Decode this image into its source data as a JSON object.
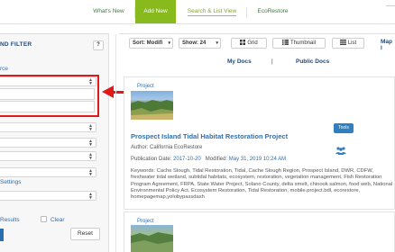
{
  "nav": {
    "tabs": [
      {
        "label": "What's New"
      },
      {
        "label": "Add New"
      },
      {
        "label": "Search & List View"
      },
      {
        "label": "EcoRestore"
      }
    ]
  },
  "filter": {
    "title": "ND FILTER",
    "help_label": "?",
    "source_label": "rce",
    "settings_label": "Settings",
    "results_label": "Results",
    "clear_label": "Clear",
    "reset_label": "Reset",
    "select_arrow": "▲▼"
  },
  "toolbar": {
    "sort_label": "Sort: Modifi",
    "show_label": "Show: 24",
    "grid_label": "Grid",
    "thumbnail_label": "Thumbnail",
    "list_label": "List",
    "map_label": "Map l"
  },
  "doc_tabs": {
    "my_docs": "My Docs",
    "separator": "|",
    "public_docs": "Public Docs"
  },
  "cards": [
    {
      "type": "Project",
      "title": "Prospect Island Tidal Habitat Restoration Project",
      "author": "Author: California EcoRestore",
      "pub_label": "Publication Date:",
      "pub_date": "2017-10-20",
      "mod_label": "Modified:",
      "mod_date": "May 31, 2019 10:24 AM",
      "tools_label": "Tools",
      "keywords": "Keywords: Cache Slough, Tidal Restoration, Tidal, Cache Slough Region, Prospect Island, DWR, CDFW, freshwater tidal wetland, subtidal habitats, ecosystem, restoration, vegetation management, Fish Restoration Program Agreement, FRPA, State Water Project, Solano County, delta smelt, chinook salmon, food web, National Environmental Policy Act, Ecosystem Restoration, Tidal Restoration, mobile.project.bdl, ecorestore, homepagemap,yolobypassdash"
    },
    {
      "type": "Project"
    }
  ],
  "colors": {
    "accent_green": "#88b91d",
    "link_blue": "#2f6fb0",
    "header_navy": "#224b7a",
    "highlight_red": "#e01a1a",
    "tools_blue": "#2f7fc1"
  }
}
